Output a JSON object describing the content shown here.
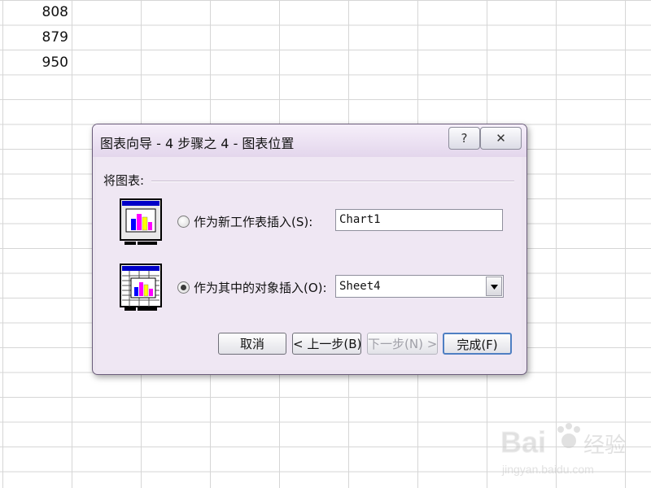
{
  "sheet": {
    "visible_values": [
      "808",
      "879",
      "950"
    ]
  },
  "dialog": {
    "title": "图表向导 - 4 步骤之 4 - 图表位置",
    "help_label": "?",
    "close_label": "✕",
    "group_label": "将图表:",
    "option_new_sheet": {
      "label": "作为新工作表插入(S):",
      "value": "Chart1",
      "selected": false
    },
    "option_object": {
      "label": "作为其中的对象插入(O):",
      "value": "Sheet4",
      "selected": true
    },
    "buttons": {
      "cancel": "取消",
      "back": "< 上一步(B)",
      "next": "下一步(N) >",
      "finish": "完成(F)"
    }
  },
  "watermark": {
    "brand": "Bai",
    "brand_cn": "经验",
    "url": "jingyan.baidu.com"
  },
  "colors": {
    "dialog_bg": "#efe7f3",
    "finish_border": "#4f7fc3",
    "chart_bar_magenta": "#ff00ff",
    "chart_bar_yellow": "#ffff00",
    "chart_bar_blue": "#0000ff"
  },
  "icons": [
    "help-icon",
    "close-icon",
    "new-sheet-chart-icon",
    "embedded-chart-icon",
    "dropdown-arrow-icon"
  ]
}
